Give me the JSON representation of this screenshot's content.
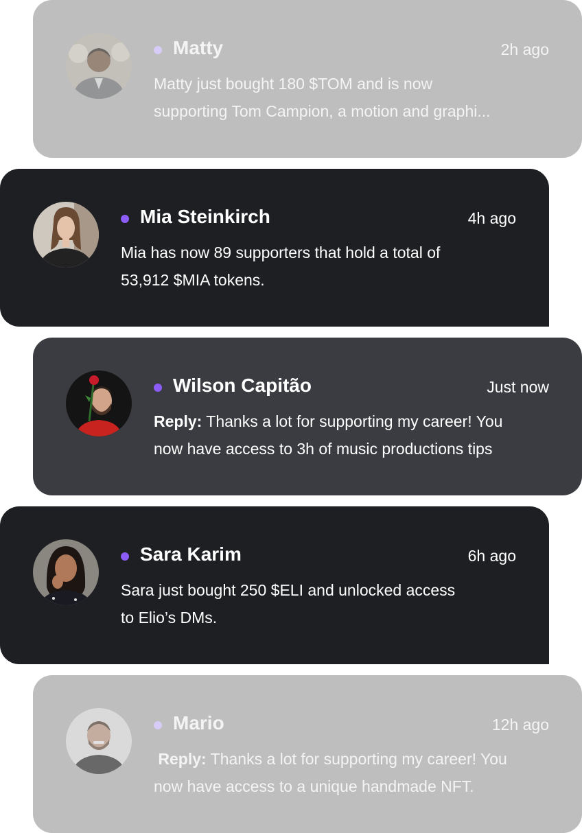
{
  "colors": {
    "faded_card": "#bdbebd",
    "dark_card": "#1e1f22",
    "mid_card": "#3b3c41",
    "accent_dot": "#8b5cf6"
  },
  "notifications": [
    {
      "name": "Matty",
      "time": "2h ago",
      "line1": "Matty just bought 180 $TOM and is now",
      "line2": "supporting Tom Campion, a motion and graphi..."
    },
    {
      "name": "Mia Steinkirch",
      "time": "4h ago",
      "line1": "Mia has now 89 supporters that hold a total of",
      "line2": "53,912 $MIA tokens."
    },
    {
      "name": "Wilson Capitão",
      "time": "Just now",
      "reply_label": "Reply:",
      "line1": " Thanks a lot for supporting my career! You",
      "line2": "now have access to 3h of music productions tips"
    },
    {
      "name": "Sara Karim",
      "time": "6h ago",
      "line1": "Sara just bought 250 $ELI and unlocked access",
      "line2": "to Elio’s DMs."
    },
    {
      "name": "Mario",
      "time": "12h ago",
      "reply_label": "Reply:",
      "line1": " Thanks a lot for supporting my career! You",
      "line2": "now have access to a unique handmade NFT."
    }
  ]
}
